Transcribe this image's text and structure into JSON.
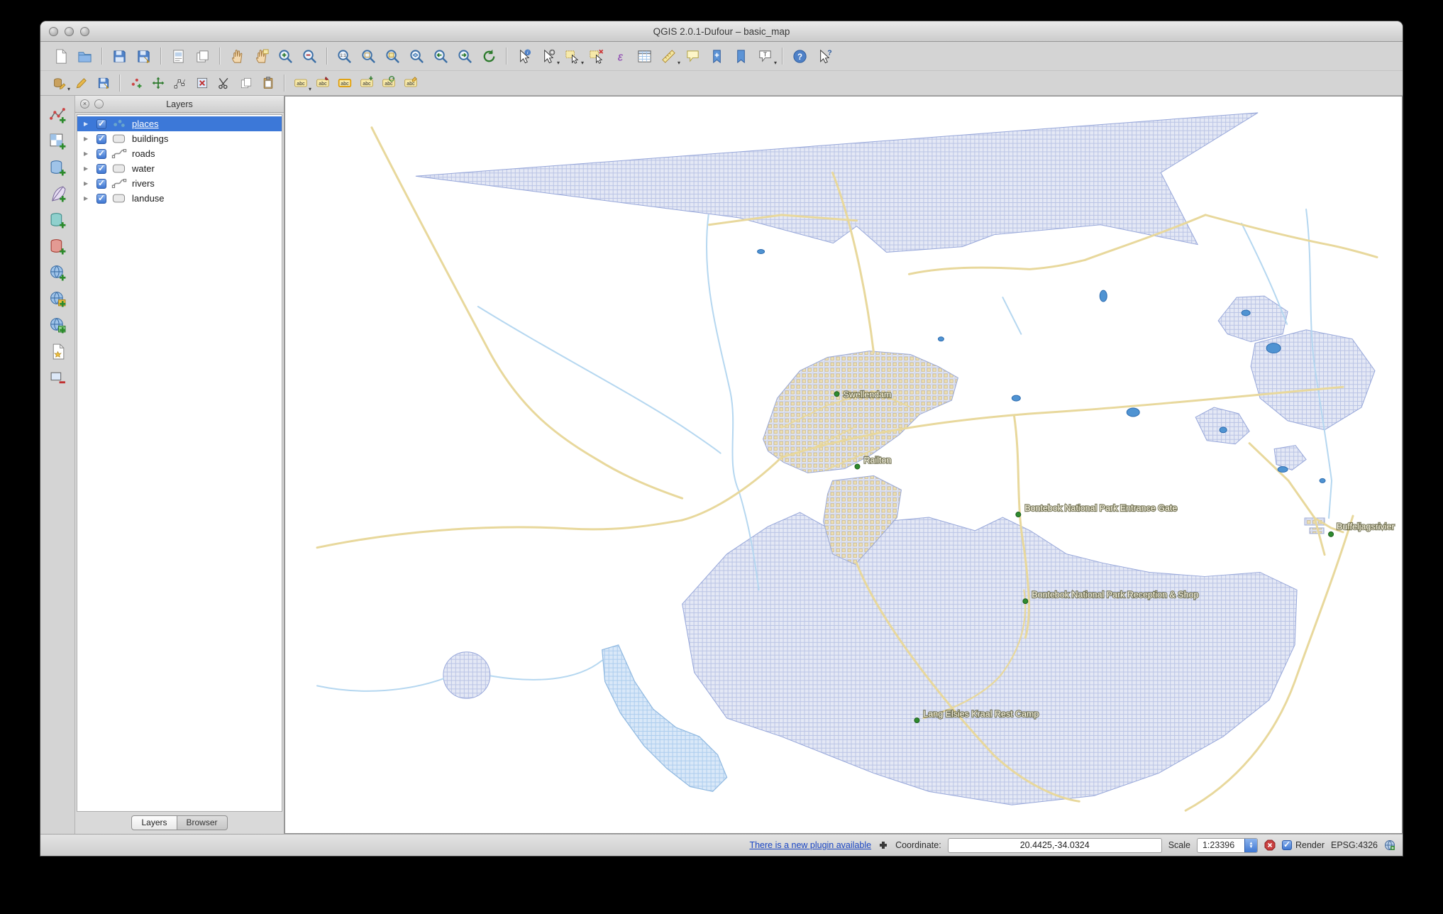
{
  "window": {
    "title": "QGIS 2.0.1-Dufour – basic_map"
  },
  "toolbars": {
    "file": [
      "new-project",
      "open-project",
      "save-project",
      "save-project-as",
      "new-print-composer",
      "composer-manager"
    ],
    "navigation": [
      "pan-map",
      "pan-to-selection",
      "zoom-in",
      "zoom-out",
      "zoom-native",
      "zoom-full",
      "zoom-to-selection",
      "zoom-to-layer",
      "zoom-last",
      "zoom-next",
      "refresh-map"
    ],
    "attributes": [
      "identify-features",
      "run-feature-action",
      "select-features",
      "deselect-features",
      "select-by-expression",
      "open-attribute-table",
      "measure",
      "map-tips",
      "new-bookmark",
      "show-bookmarks",
      "text-annotation",
      "help-contents",
      "whats-this"
    ],
    "digitizing": [
      "current-edits",
      "toggle-editing",
      "save-layer-edits",
      "add-feature",
      "move-feature",
      "node-tool",
      "delete-selected",
      "cut-features",
      "copy-features",
      "paste-features"
    ],
    "labeling": [
      "labeling-options",
      "pin-unpin-labels",
      "highlight-pinned-labels",
      "move-label",
      "rotate-label",
      "change-label-properties"
    ],
    "manage_layers": [
      "add-vector-layer",
      "add-raster-layer",
      "add-postgis-layer",
      "add-spatialite-layer",
      "add-mssql-layer",
      "add-oracle-layer",
      "add-wms-layer",
      "add-wcs-layer",
      "add-wfs-layer",
      "new-shapefile-layer",
      "remove-layer"
    ]
  },
  "layers_panel": {
    "title": "Layers",
    "layers": [
      {
        "name": "places",
        "checked": true,
        "selected": true,
        "geometry": "point"
      },
      {
        "name": "buildings",
        "checked": true,
        "selected": false,
        "geometry": "polygon"
      },
      {
        "name": "roads",
        "checked": true,
        "selected": false,
        "geometry": "line"
      },
      {
        "name": "water",
        "checked": true,
        "selected": false,
        "geometry": "polygon"
      },
      {
        "name": "rivers",
        "checked": true,
        "selected": false,
        "geometry": "line"
      },
      {
        "name": "landuse",
        "checked": true,
        "selected": false,
        "geometry": "polygon"
      }
    ],
    "tabs": [
      {
        "label": "Layers",
        "active": true
      },
      {
        "label": "Browser",
        "active": false
      }
    ]
  },
  "map": {
    "labels": [
      {
        "text": "Swellendam"
      },
      {
        "text": "Railton"
      },
      {
        "text": "Bontebok National Park Entrance Gate"
      },
      {
        "text": "Buffeljagsrivier"
      },
      {
        "text": "Bontebok National Park Reception & Shop"
      },
      {
        "text": "Lang Elsies Kraal Rest Camp"
      }
    ],
    "colors": {
      "road": "#e8d89c",
      "river": "#b5d7f0",
      "water_fill": "#4f93d2",
      "landuse_fill": "#e4e8f5",
      "landuse_grid": "#b3bde2",
      "building": "#ecdfb4",
      "place_marker": "#2e8b2e"
    }
  },
  "status_bar": {
    "plugin_link": "There is a new plugin available",
    "coordinate_label": "Coordinate:",
    "coordinate_value": "20.4425,-34.0324",
    "scale_label": "Scale",
    "scale_value": "1:23396",
    "render_label": "Render",
    "crs": "EPSG:4326"
  }
}
